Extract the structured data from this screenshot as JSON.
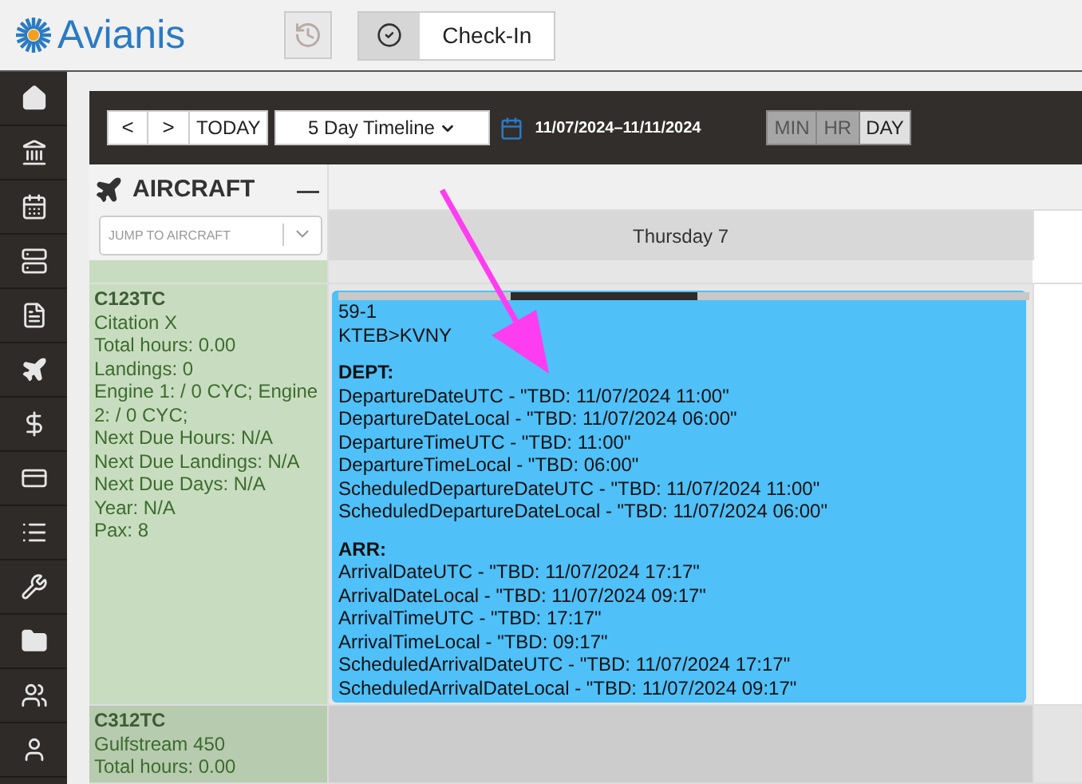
{
  "header": {
    "logo": "Avianis",
    "check_in": "Check-In"
  },
  "sidebar": {
    "items": [
      {
        "kind": "home"
      },
      {
        "kind": "bank"
      },
      {
        "kind": "calendar"
      },
      {
        "kind": "server"
      },
      {
        "kind": "invoice"
      },
      {
        "kind": "plane"
      },
      {
        "kind": "dollar"
      },
      {
        "kind": "card"
      },
      {
        "kind": "list"
      },
      {
        "kind": "wrench"
      },
      {
        "kind": "folder"
      },
      {
        "kind": "users"
      },
      {
        "kind": "user"
      }
    ]
  },
  "toolbar": {
    "prev": "<",
    "next": ">",
    "today": "TODAY",
    "view": "5 Day Timeline",
    "date_range": "11/07/2024–11/11/2024",
    "scales": [
      {
        "label": "MIN",
        "selected": false
      },
      {
        "label": "HR",
        "selected": false
      },
      {
        "label": "DAY",
        "selected": true
      }
    ]
  },
  "aircraft_panel": {
    "title": "AIRCRAFT",
    "collapse": "—",
    "jump_placeholder": "JUMP TO AIRCRAFT"
  },
  "columns": [
    {
      "label": "Thursday 7"
    }
  ],
  "aircraft": [
    {
      "tail": "C123TC",
      "lines": [
        "Citation X",
        "Total hours: 0.00",
        "Landings: 0",
        "Engine 1: / 0 CYC; Engine 2: / 0 CYC;",
        "Next Due Hours: N/A",
        "Next Due Landings: N/A",
        "Next Due Days: N/A",
        "Year: N/A",
        "Pax: 8"
      ],
      "event": {
        "trip": "59-1",
        "route": "KTEB>KVNY",
        "sections": [
          {
            "heading": "DEPT:",
            "lines": [
              "DepartureDateUTC - \"TBD: 11/07/2024 11:00\"",
              "DepartureDateLocal - \"TBD: 11/07/2024 06:00\"",
              "DepartureTimeUTC - \"TBD: 11:00\"",
              "DepartureTimeLocal - \"TBD: 06:00\"",
              "ScheduledDepartureDateUTC - \"TBD: 11/07/2024 11:00\"",
              "ScheduledDepartureDateLocal - \"TBD: 11/07/2024 06:00\""
            ]
          },
          {
            "heading": "ARR:",
            "lines": [
              "ArrivalDateUTC - \"TBD: 11/07/2024 17:17\"",
              "ArrivalDateLocal - \"TBD: 11/07/2024 09:17\"",
              "ArrivalTimeUTC - \"TBD: 17:17\"",
              "ArrivalTimeLocal - \"TBD: 09:17\"",
              "ScheduledArrivalDateUTC - \"TBD: 11/07/2024 17:17\"",
              "ScheduledArrivalDateLocal - \"TBD: 11/07/2024 09:17\""
            ]
          }
        ]
      }
    },
    {
      "tail": "C312TC",
      "lines": [
        "Gulfstream 450",
        "Total hours: 0.00"
      ]
    }
  ]
}
